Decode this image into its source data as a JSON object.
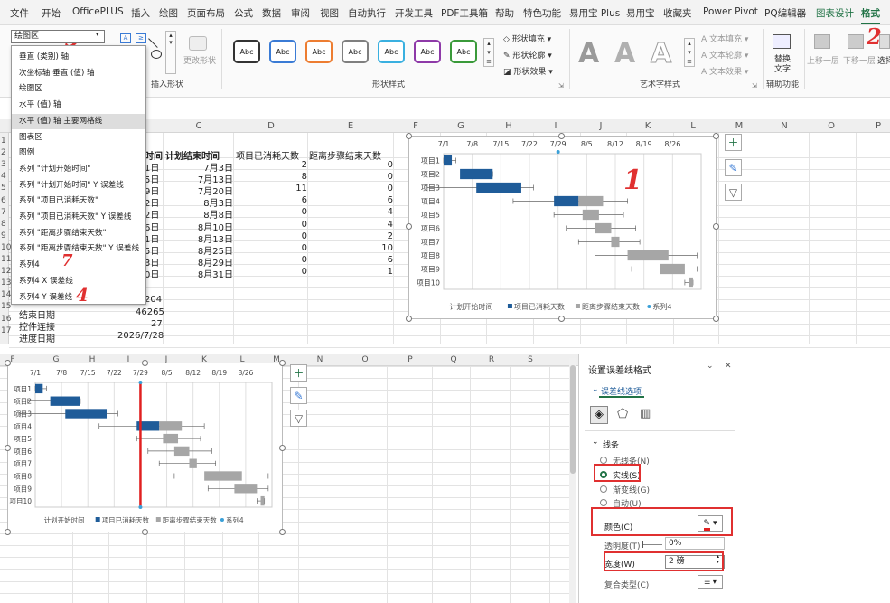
{
  "menu": {
    "tabs": [
      "文件",
      "开始",
      "OfficePLUS",
      "插入",
      "绘图",
      "页面布局",
      "公式",
      "数据",
      "审阅",
      "视图",
      "自动执行",
      "开发工具",
      "PDF工具箱",
      "帮助",
      "特色功能",
      "易用宝 Plus",
      "易用宝",
      "收藏夹",
      "Power Pivot",
      "PQ编辑器",
      "图表设计",
      "格式"
    ]
  },
  "ribbon": {
    "selection_value": "绘图区",
    "change_shape": "更改形状",
    "insert_shapes": "插入形状",
    "shape_styles": "形状样式",
    "abc": "Abc",
    "shape_fill": "形状填充",
    "shape_outline": "形状轮廓",
    "shape_effect": "形状效果",
    "wordart_styles": "艺术字样式",
    "text_fill": "文本填充",
    "text_outline": "文本轮廓",
    "text_effect": "文本效果",
    "alt_text_line1": "替换",
    "alt_text_line2": "文字",
    "accessibility": "辅助功能",
    "bring_forward": "上移一层",
    "send_backward": "下移一层",
    "select": "选择",
    "wordart_letter": "A"
  },
  "dropdown": {
    "items": [
      "垂直 (类别) 轴",
      "次坐标轴 垂直 (值) 轴",
      "绘图区",
      "水平 (值) 轴",
      "水平 (值) 轴 主要网格线",
      "图表区",
      "图例",
      "系列 \"计划开始时间\"",
      "系列 \"计划开始时间\" Y 误差线",
      "系列 \"项目已消耗天数\"",
      "系列 \"项目已消耗天数\" Y 误差线",
      "系列 \"距离步骤结束天数\"",
      "系列 \"距离步骤结束天数\" Y 误差线",
      "系列4",
      "系列4 X 误差线",
      "系列4 Y 误差线"
    ],
    "highlight_index": 4
  },
  "sheet": {
    "col_letters_top": [
      "C",
      "D",
      "E",
      "F",
      "G",
      "H",
      "I",
      "J",
      "K",
      "L",
      "M",
      "N",
      "O",
      "P"
    ],
    "header_partial": "时间",
    "headers": [
      "计划结束时间",
      "项目已消耗天数",
      "距离步骤结束天数"
    ],
    "b_partial": [
      "1日",
      "5日",
      "9日",
      "2日",
      "2日",
      "6日",
      "1日",
      "5日",
      "3日",
      "0日"
    ],
    "c": [
      "7月3日",
      "7月13日",
      "7月20日",
      "8月3日",
      "8月8日",
      "8月10日",
      "8月13日",
      "8月25日",
      "8月29日",
      "8月31日"
    ],
    "d": [
      "2",
      "8",
      "11",
      "6",
      "0",
      "0",
      "0",
      "0",
      "0",
      "0"
    ],
    "e": [
      "0",
      "0",
      "0",
      "6",
      "4",
      "4",
      "2",
      "10",
      "6",
      "1"
    ],
    "rows": [
      "1",
      "2",
      "3",
      "4",
      "5",
      "6",
      "7",
      "8",
      "9",
      "10",
      "11",
      "12",
      "13",
      "14",
      "15",
      "16",
      "17"
    ],
    "b14": "204",
    "labels": [
      {
        "label": "结束日期",
        "value": "46265"
      },
      {
        "label": "控件连接",
        "value": "27"
      },
      {
        "label": "进度日期",
        "value": "2026/7/28"
      }
    ],
    "col_letters_bottom": [
      "F",
      "G",
      "H",
      "I",
      "J",
      "K",
      "L",
      "M",
      "N",
      "O",
      "P",
      "Q",
      "R",
      "S"
    ]
  },
  "chart": {
    "dates": [
      "7/1",
      "7/8",
      "7/15",
      "7/22",
      "7/29",
      "8/5",
      "8/12",
      "8/19",
      "8/26"
    ],
    "items": [
      "项目1",
      "项目2",
      "项目3",
      "项目4",
      "项目5",
      "项目6",
      "项目7",
      "项目8",
      "项目9",
      "项目10"
    ],
    "legend": [
      "计划开始时间",
      "项目已消耗天数",
      "距离步骤结束天数",
      "系列4"
    ],
    "colors": {
      "blue": "#1f5c99",
      "gray": "#a6a6a6",
      "marker": "#3aa0d8",
      "red": "#e02020"
    }
  },
  "pane": {
    "title": "设置误差线格式",
    "section": "误差线选项",
    "line_header": "线条",
    "options": [
      "无线条(N)",
      "实线(S)",
      "渐变线(G)",
      "自动(U)"
    ],
    "selected_index": 1,
    "color_label": "颜色(C)",
    "transparency_label": "透明度(T)",
    "transparency_value": "0%",
    "width_label": "宽度(W)",
    "width_value": "2 磅",
    "compound_label": "复合类型(C)"
  },
  "annotations": {
    "n1": "1",
    "n2": "2",
    "n3": "3",
    "n4": "4",
    "n7": "7"
  }
}
